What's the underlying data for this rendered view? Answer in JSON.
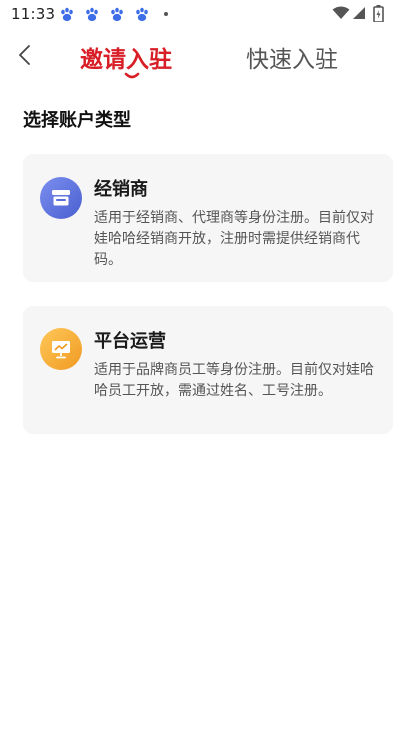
{
  "status_bar": {
    "time": "11:33",
    "notification_icons": [
      "paw-icon",
      "paw-icon",
      "paw-icon",
      "paw-icon"
    ],
    "system_icons": [
      "wifi-icon",
      "signal-icon",
      "battery-icon"
    ]
  },
  "nav": {
    "back_icon": "chevron-left-icon",
    "tabs": [
      {
        "label": "邀请入驻",
        "active": true
      },
      {
        "label": "快速入驻",
        "active": false
      }
    ]
  },
  "main": {
    "section_title": "选择账户类型",
    "cards": [
      {
        "icon": "store-icon",
        "title": "经销商",
        "description": "适用于经销商、代理商等身份注册。目前仅对娃哈哈经销商开放，注册时需提供经销商代码。"
      },
      {
        "icon": "presentation-icon",
        "title": "平台运营",
        "description": "适用于品牌商员工等身份注册。目前仅对娃哈哈员工开放，需通过姓名、工号注册。"
      }
    ]
  },
  "colors": {
    "accent": "#d81e26",
    "card_bg": "#f6f6f7",
    "distributor_icon": "#5b6fdc",
    "operations_icon": "#f5ab34"
  }
}
